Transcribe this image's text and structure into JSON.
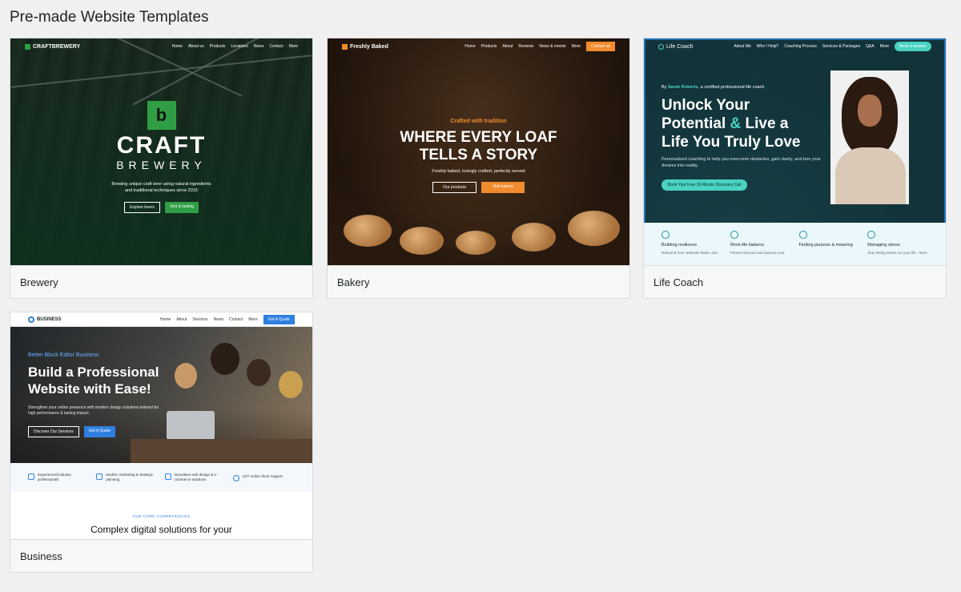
{
  "page": {
    "title": "Pre-made Website Templates"
  },
  "colors": {
    "selected_outline": "#2271b1",
    "brewery_green": "#2f9e44",
    "bakery_orange": "#f08c2e",
    "coach_teal": "#49d3c0",
    "business_blue": "#2f7fe0"
  },
  "templates": [
    {
      "label": "Brewery",
      "preview": {
        "logo": "CRAFTBREWERY",
        "nav": [
          "Home",
          "About us",
          "Products",
          "Locations",
          "News",
          "Contact",
          "More"
        ],
        "badge_letter": "b",
        "title_top": "CRAFT",
        "title_bottom": "BREWERY",
        "tagline_1": "Brewing unique craft beer using natural ingredients",
        "tagline_2": "and traditional techniques since 2015",
        "btn_primary": "Explore beers",
        "btn_secondary": "Visit & tasting"
      }
    },
    {
      "label": "Bakery",
      "preview": {
        "logo": "Freshly Baked",
        "nav": [
          "Home",
          "Products",
          "About",
          "Reviews",
          "News & events",
          "More"
        ],
        "nav_cta": "Contact us",
        "pretitle": "Crafted with tradition",
        "title_1": "WHERE EVERY LOAF",
        "title_2": "TELLS A STORY",
        "subtitle": "Freshly baked, lovingly crafted, perfectly served",
        "btn_primary": "Our products",
        "btn_secondary": "Visit bakery"
      }
    },
    {
      "label": "Life Coach",
      "preview": {
        "logo": "Life Coach",
        "nav": [
          "About Me",
          "Who I Help?",
          "Coaching Process",
          "Services & Packages",
          "Q&A",
          "More"
        ],
        "nav_cta": "Book a session",
        "by_prefix": "By",
        "by_name": "Sarah Roberts",
        "by_suffix": ", a certified professional life coach",
        "title_1": "Unlock Your",
        "title_2a": "Potential",
        "title_2b": "&",
        "title_2c": "Live a",
        "title_3": "Life You Truly Love",
        "paragraph": "Personalized coaching to help you overcome obstacles, gain clarity, and turn your dreams into reality.",
        "cta": "Book Your Free 30-Minute Discovery Call",
        "features": [
          {
            "title": "Building resilience",
            "desc": "Rebound from setbacks faster, and"
          },
          {
            "title": "Work-life balance",
            "desc": "Prevent burnout and improve your"
          },
          {
            "title": "Finding purpose & meaning",
            "desc": ""
          },
          {
            "title": "Managing stress",
            "desc": "Stop letting stress run your life - learn"
          }
        ]
      }
    },
    {
      "label": "Business",
      "preview": {
        "logo": "BUSINESS",
        "nav": [
          "Home",
          "About",
          "Services",
          "News",
          "Contact",
          "More"
        ],
        "nav_cta": "Get A Quote",
        "pretitle": "Better Block Editor Business",
        "title": "Build a Professional Website with Ease!",
        "paragraph": "Strengthen your online presence with modern design solutions tailored for high performance & lasting impact.",
        "btn_primary": "Discover Our Services",
        "btn_secondary": "Get A Quote",
        "features": [
          "Experienced industry professionals",
          "Modern marketing & strategic planning",
          "Innovative web design & e-commerce solutions",
          "24/7 online client support"
        ],
        "section_label": "OUR CORE COMPETENCIES",
        "section_title": "Complex digital solutions for your"
      }
    }
  ]
}
